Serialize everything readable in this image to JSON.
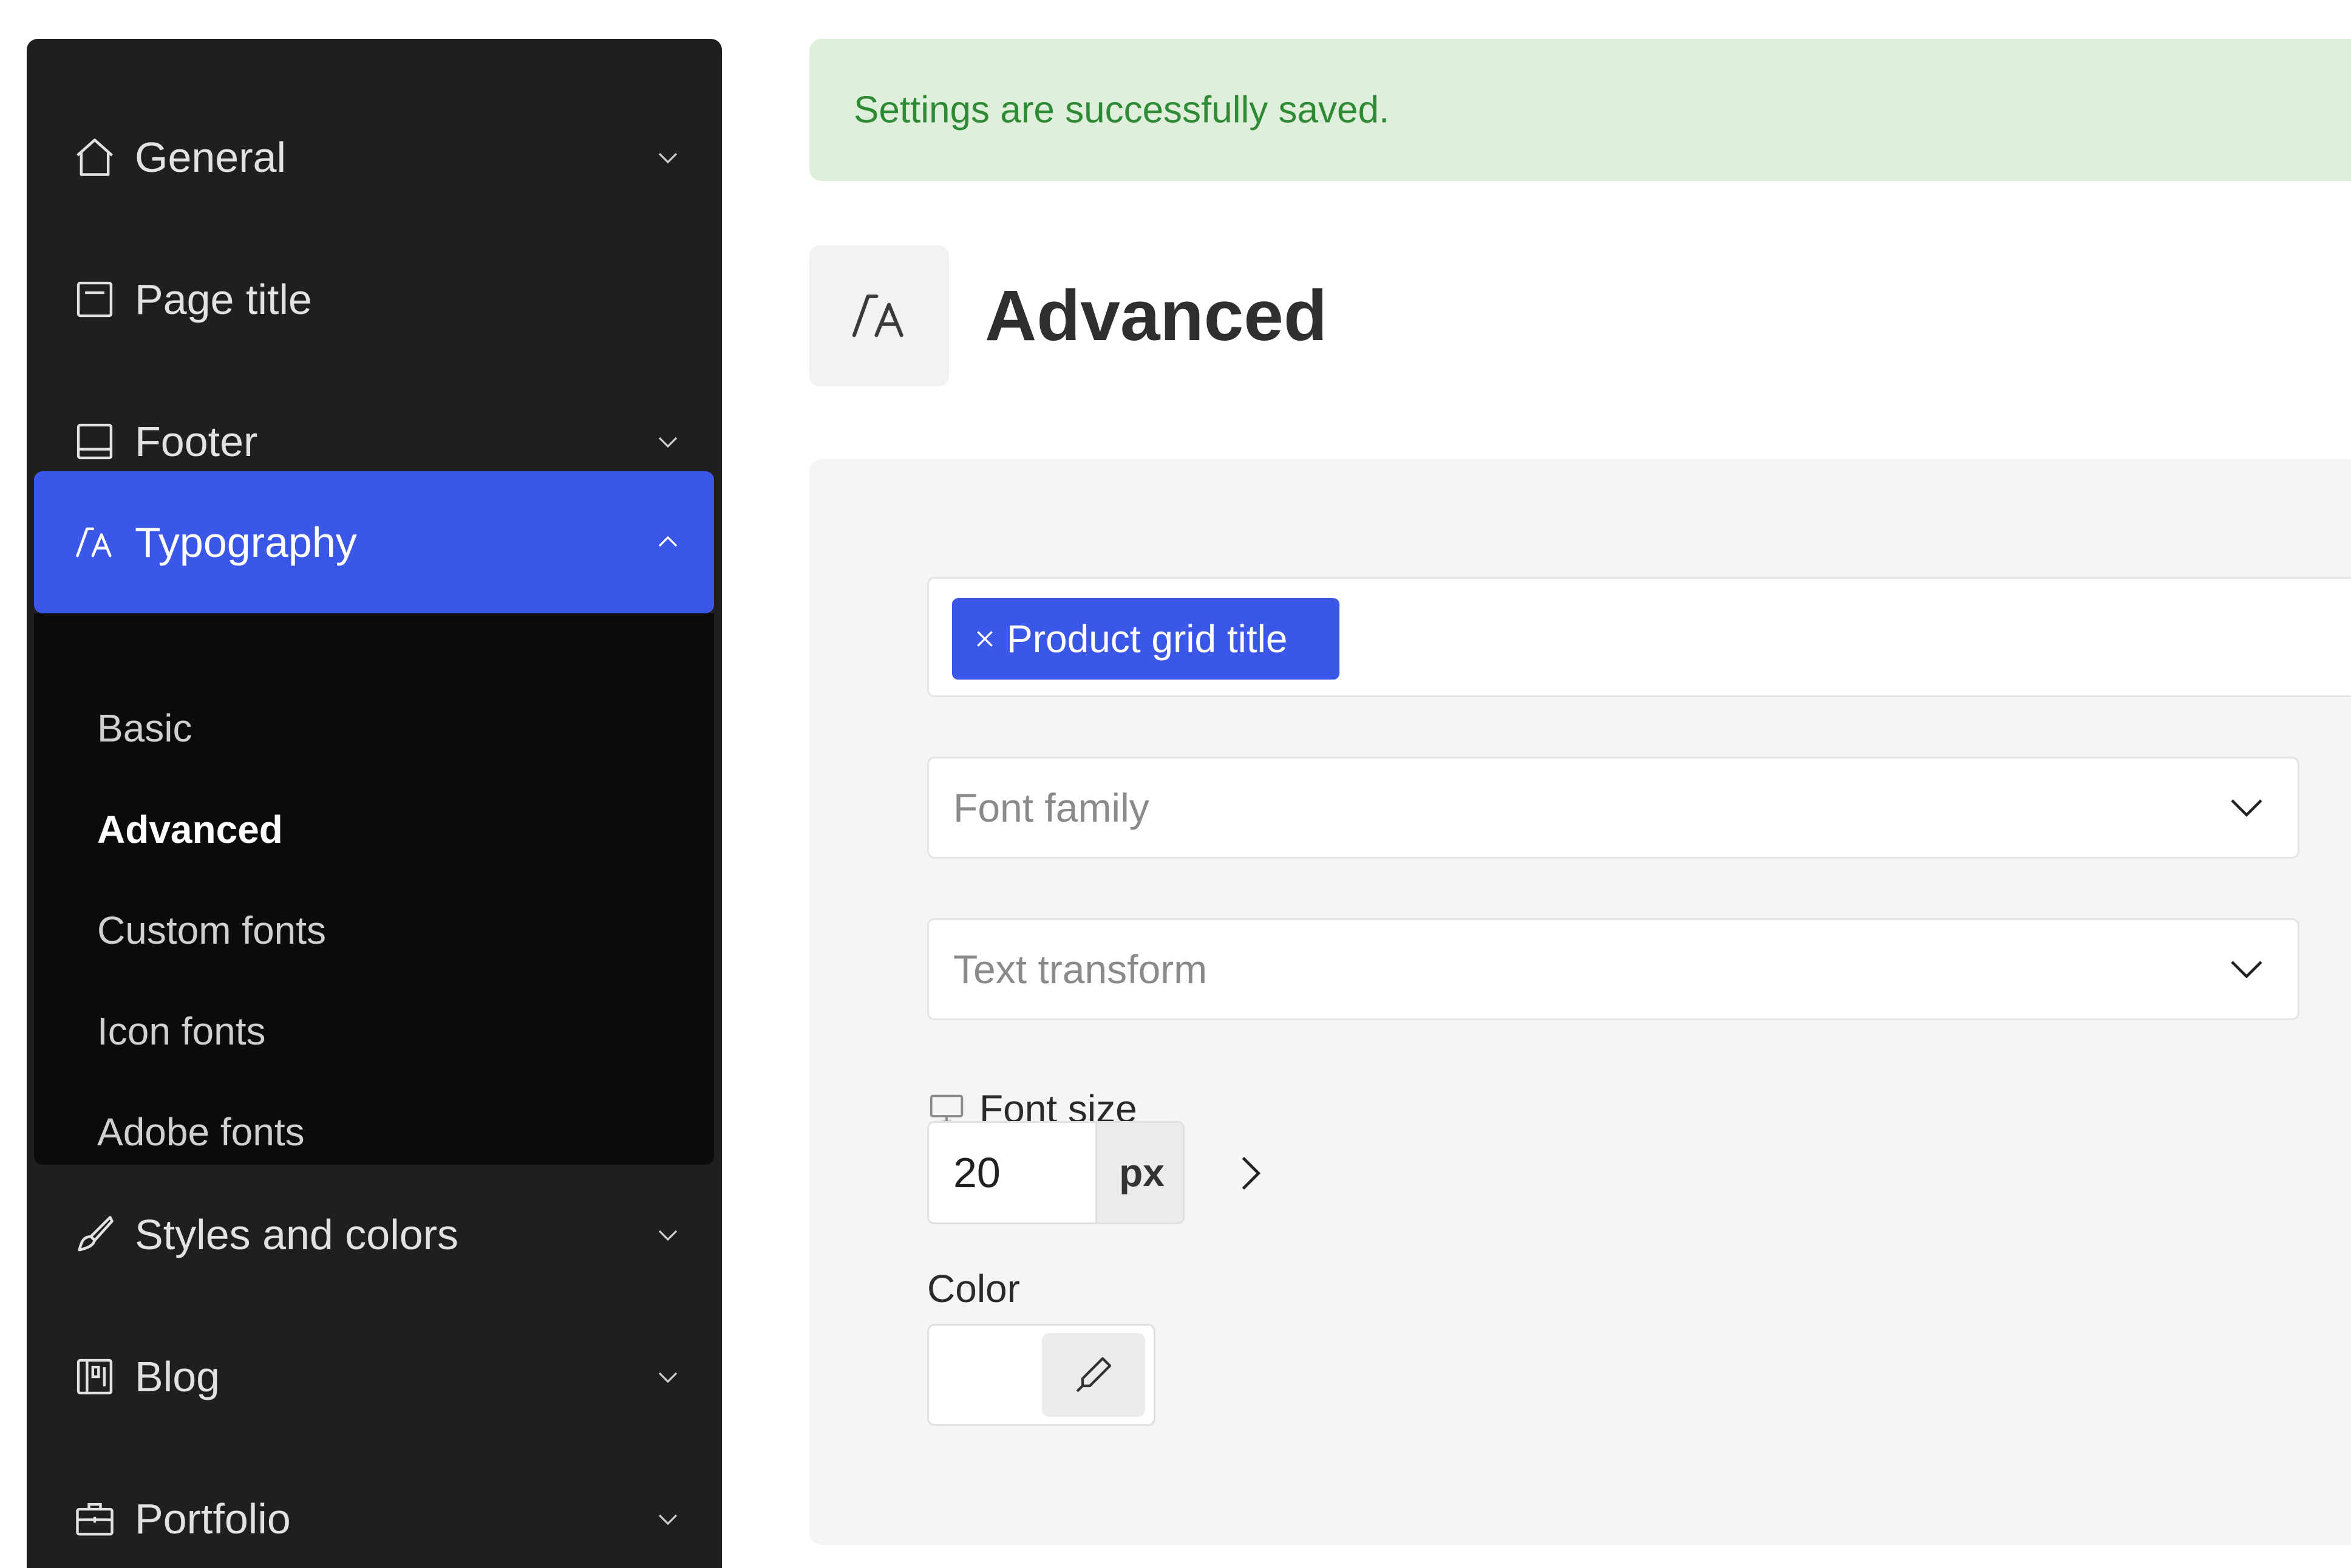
{
  "sidebar": {
    "items": [
      {
        "label": "General",
        "icon": "home-icon",
        "expandable": true,
        "expanded": false
      },
      {
        "label": "Page title",
        "icon": "page-title-icon",
        "expandable": false
      },
      {
        "label": "Footer",
        "icon": "footer-icon",
        "expandable": true,
        "expanded": false
      },
      {
        "label": "Typography",
        "icon": "typography-icon",
        "expandable": true,
        "expanded": true,
        "active": true
      },
      {
        "label": "Styles and colors",
        "icon": "brush-icon",
        "expandable": true,
        "expanded": false
      },
      {
        "label": "Blog",
        "icon": "blog-icon",
        "expandable": true,
        "expanded": false
      },
      {
        "label": "Portfolio",
        "icon": "briefcase-icon",
        "expandable": true,
        "expanded": false
      }
    ],
    "submenu": [
      {
        "label": "Basic",
        "current": false
      },
      {
        "label": "Advanced",
        "current": true
      },
      {
        "label": "Custom fonts",
        "current": false
      },
      {
        "label": "Icon fonts",
        "current": false
      },
      {
        "label": "Adobe fonts",
        "current": false
      }
    ],
    "active_color": "#3b57e8"
  },
  "alert": {
    "message": "Settings are successfully saved.",
    "type": "success"
  },
  "header": {
    "title": "Advanced",
    "icon": "typography-icon"
  },
  "form": {
    "selected_tag": "Product grid title",
    "font_family": {
      "placeholder": "Font family",
      "value": ""
    },
    "text_transform": {
      "placeholder": "Text transform",
      "value": ""
    },
    "font_size": {
      "label": "Font size",
      "value": "20",
      "unit": "px",
      "device_icon": "desktop-icon"
    },
    "color": {
      "label": "Color",
      "value": ""
    }
  }
}
